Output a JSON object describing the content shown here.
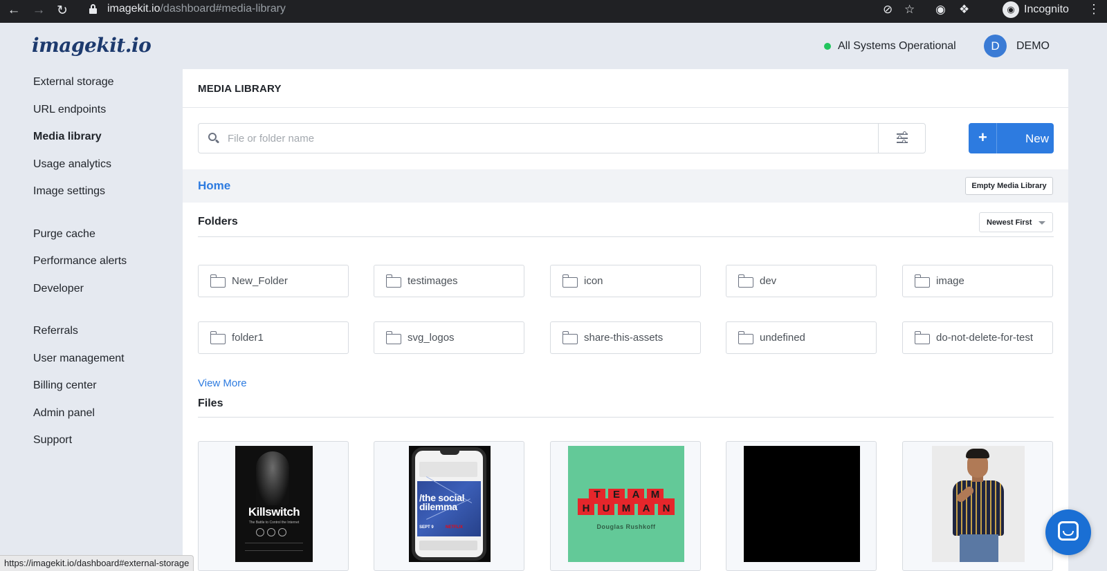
{
  "browser": {
    "url_host": "imagekit.io",
    "url_path": "/dashboard#media-library",
    "profile_label": "Incognito",
    "status_url": "https://imagekit.io/dashboard#external-storage"
  },
  "header": {
    "logo": "imagekit.io",
    "system_status": "All Systems Operational",
    "avatar_initial": "D",
    "account_name": "DEMO"
  },
  "sidebar": {
    "items": [
      {
        "label": "External storage"
      },
      {
        "label": "URL endpoints"
      },
      {
        "label": "Media library"
      },
      {
        "label": "Usage analytics"
      },
      {
        "label": "Image settings"
      },
      {
        "label": "Purge cache"
      },
      {
        "label": "Performance alerts"
      },
      {
        "label": "Developer"
      },
      {
        "label": "Referrals"
      },
      {
        "label": "User management"
      },
      {
        "label": "Billing center"
      },
      {
        "label": "Admin panel"
      },
      {
        "label": "Support"
      }
    ]
  },
  "main": {
    "title": "MEDIA LIBRARY",
    "search_placeholder": "File or folder name",
    "new_button": "New",
    "new_button_icon": "+",
    "breadcrumb": "Home",
    "empty_button": "Empty Media Library",
    "folders_title": "Folders",
    "sort_selected": "Newest First",
    "folders": [
      {
        "name": "New_Folder"
      },
      {
        "name": "testimages"
      },
      {
        "name": "icon"
      },
      {
        "name": "dev"
      },
      {
        "name": "image"
      },
      {
        "name": "folder1"
      },
      {
        "name": "svg_logos"
      },
      {
        "name": "share-this-assets"
      },
      {
        "name": "undefined"
      },
      {
        "name": "do-not-delete-for-test"
      }
    ],
    "view_more": "View More",
    "files_title": "Files",
    "file_thumbs": {
      "killswitch_title": "Killswitch",
      "killswitch_sub": "The Battle to Control the Internet",
      "social_title": "/the social dilemma",
      "social_date": "SEPT 9",
      "social_brand": "NETFLIX",
      "team_top": [
        "T",
        "E",
        "A",
        "M"
      ],
      "team_bottom": [
        "H",
        "U",
        "M",
        "A",
        "N"
      ],
      "team_author": "Douglas Rushkoff"
    }
  },
  "colors": {
    "accent": "#2d7be0",
    "status_green": "#22c55e",
    "logo_navy": "#1d3a6e"
  }
}
